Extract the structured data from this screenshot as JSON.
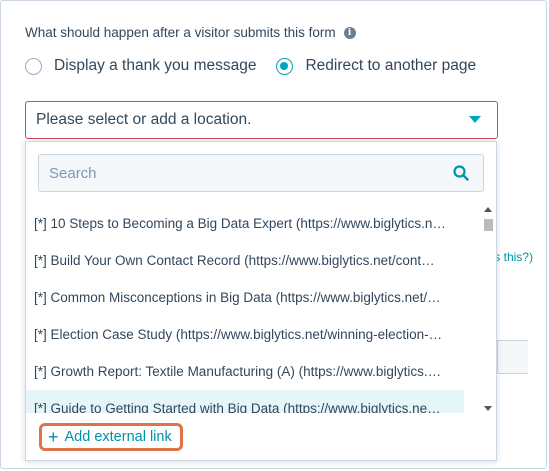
{
  "question": {
    "label": "What should happen after a visitor submits this form",
    "info_icon": "info-icon"
  },
  "options": [
    {
      "label": "Display a thank you message",
      "selected": false
    },
    {
      "label": "Redirect to another page",
      "selected": true
    }
  ],
  "select": {
    "placeholder": "Please select or add a location."
  },
  "background": {
    "partial_link": "'s this?)"
  },
  "dropdown": {
    "search_placeholder": "Search",
    "items": [
      "[*] 10 Steps to Becoming a Big Data Expert (https://www.biglytics.n…",
      "[*] Build Your Own Contact Record (https://www.biglytics.net/cont…",
      "[*] Common Misconceptions in Big Data (https://www.biglytics.net/…",
      "[*] Election Case Study (https://www.biglytics.net/winning-election-…",
      "[*] Growth Report: Textile Manufacturing (A) (https://www.biglytics.…",
      "[*] Guide to Getting Started with Big Data (https://www.biglytics.ne…"
    ],
    "add_link_label": "Add external link"
  },
  "colors": {
    "accent": "#00a4bd",
    "error_border": "#d0465c",
    "highlight": "#e0724a",
    "link": "#0091ae"
  }
}
